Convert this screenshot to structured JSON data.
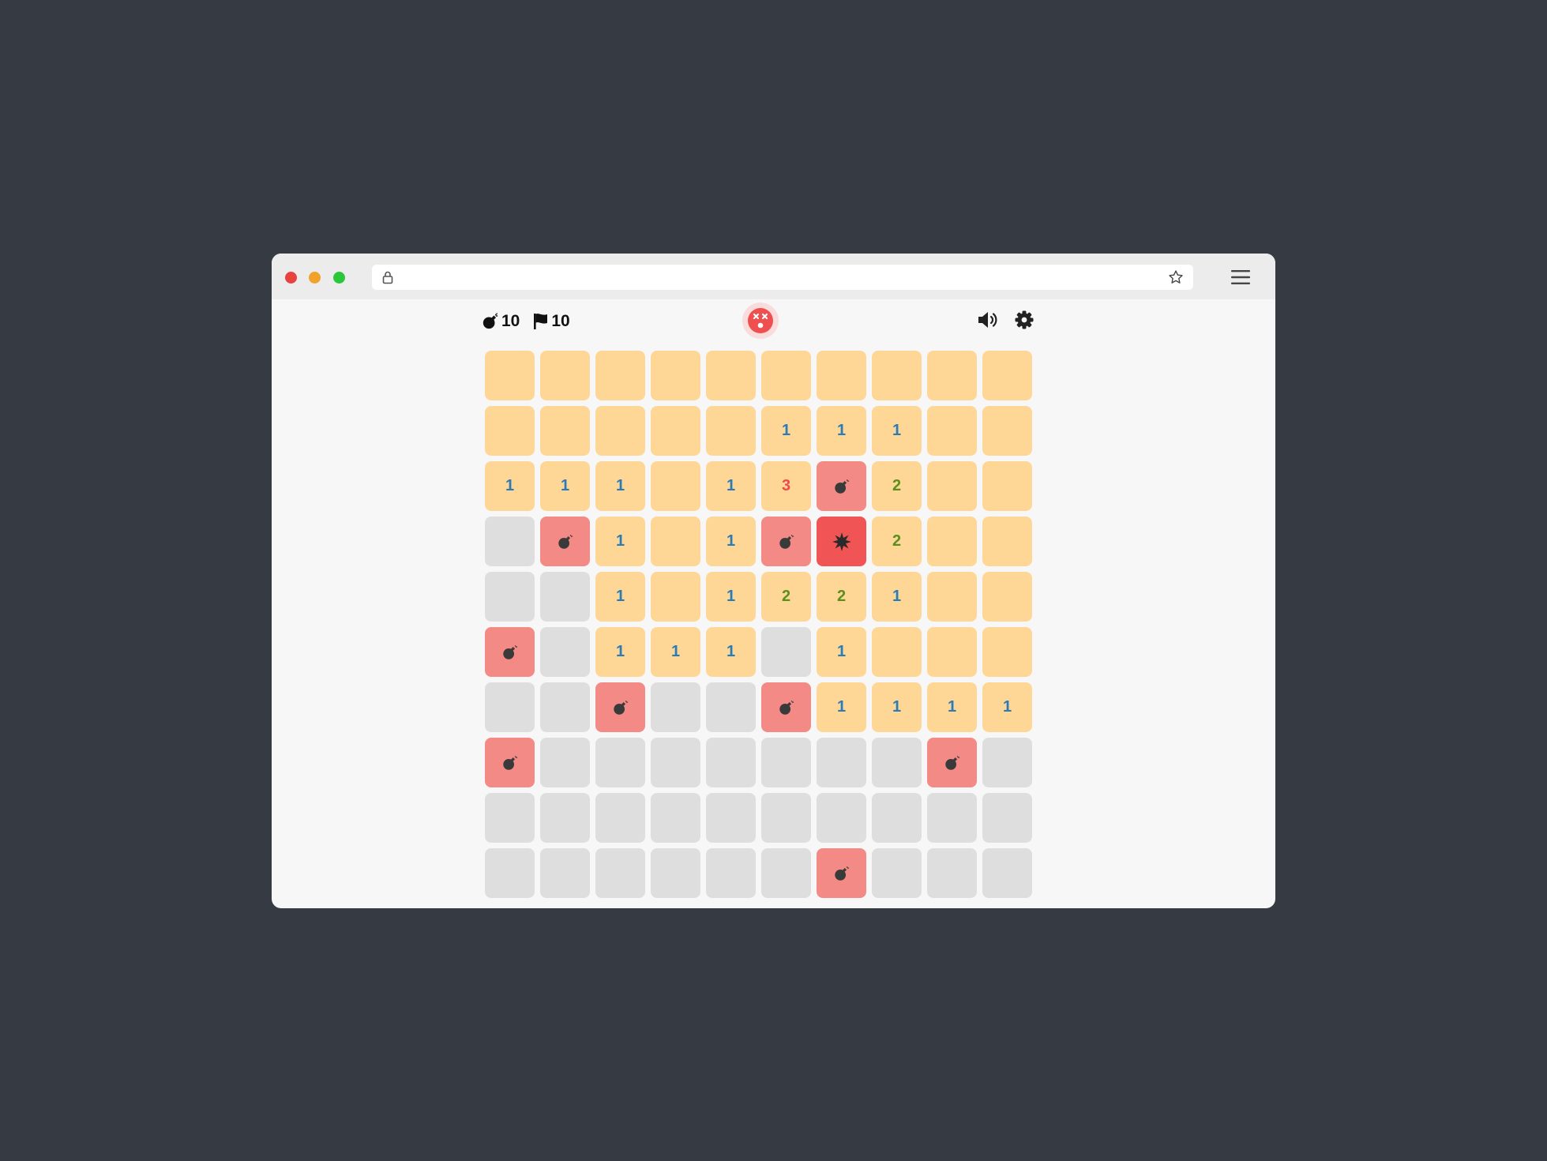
{
  "browser": {
    "address": "",
    "icons": [
      "lock-icon",
      "star-icon",
      "hamburger-menu-icon"
    ]
  },
  "hud": {
    "mines_remaining": "10",
    "flags_remaining": "10",
    "status_face": "dead-face",
    "icons": [
      "bomb-icon",
      "flag-icon",
      "speaker-icon",
      "gear-icon"
    ]
  },
  "colors": {
    "revealed": "#fed797",
    "hidden": "#dedede",
    "mine": "#f38a86",
    "exploded": "#f05454",
    "number_1": "#2b7bb5",
    "number_2": "#5a8f1d",
    "number_3": "#ee4a4a"
  },
  "board": {
    "rows": 10,
    "cols": 10,
    "legend": {
      "R": "revealed-empty",
      "H": "hidden",
      "M": "mine",
      "X": "exploded-mine",
      "1-8": "revealed-number"
    },
    "grid": [
      [
        "R",
        "R",
        "R",
        "R",
        "R",
        "R",
        "R",
        "R",
        "R",
        "R"
      ],
      [
        "R",
        "R",
        "R",
        "R",
        "R",
        "1",
        "1",
        "1",
        "R",
        "R"
      ],
      [
        "1",
        "1",
        "1",
        "R",
        "1",
        "3",
        "M",
        "2",
        "R",
        "R"
      ],
      [
        "H",
        "M",
        "1",
        "R",
        "1",
        "M",
        "X",
        "2",
        "R",
        "R"
      ],
      [
        "H",
        "H",
        "1",
        "R",
        "1",
        "2",
        "2",
        "1",
        "R",
        "R"
      ],
      [
        "M",
        "H",
        "1",
        "1",
        "1",
        "H",
        "1",
        "R",
        "R",
        "R"
      ],
      [
        "H",
        "H",
        "M",
        "H",
        "H",
        "M",
        "1",
        "1",
        "1",
        "1"
      ],
      [
        "M",
        "H",
        "H",
        "H",
        "H",
        "H",
        "H",
        "H",
        "M",
        "H"
      ],
      [
        "H",
        "H",
        "H",
        "H",
        "H",
        "H",
        "H",
        "H",
        "H",
        "H"
      ],
      [
        "H",
        "H",
        "H",
        "H",
        "H",
        "H",
        "M",
        "H",
        "H",
        "H"
      ]
    ]
  }
}
